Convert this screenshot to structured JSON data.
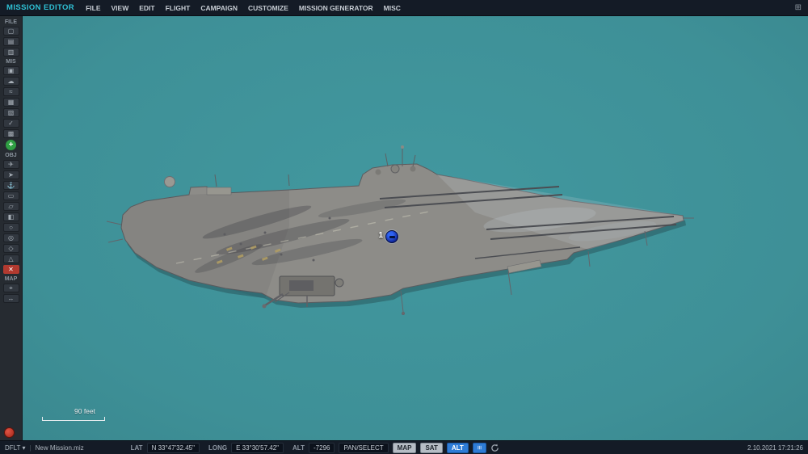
{
  "titlebar": {
    "app_title": "MISSION EDITOR",
    "menu_items": [
      "FILE",
      "VIEW",
      "EDIT",
      "FLIGHT",
      "CAMPAIGN",
      "CUSTOMIZE",
      "MISSION GENERATOR",
      "MISC"
    ],
    "window_icon": "⊞"
  },
  "toolbar": {
    "sections": [
      {
        "label": "FILE",
        "items": [
          {
            "name": "new-mission-icon",
            "glyph": "▢"
          },
          {
            "name": "open-mission-icon",
            "glyph": "▤"
          },
          {
            "name": "save-mission-icon",
            "glyph": "▥"
          }
        ]
      },
      {
        "label": "MIS",
        "items": [
          {
            "name": "briefing-icon",
            "glyph": "▣"
          },
          {
            "name": "weather-icon",
            "glyph": "☁"
          },
          {
            "name": "routes-icon",
            "glyph": "≈"
          },
          {
            "name": "mission-options-icon",
            "glyph": "▦"
          },
          {
            "name": "triggers-icon",
            "glyph": "▧"
          },
          {
            "name": "goals-icon",
            "glyph": "✓"
          },
          {
            "name": "summary-icon",
            "glyph": "▩"
          },
          {
            "name": "add-unit-icon",
            "glyph": "+",
            "bg": "#2f9e43",
            "fg": "#ffffff",
            "shape": "circle"
          }
        ]
      },
      {
        "label": "OBJ",
        "items": [
          {
            "name": "aircraft-icon",
            "glyph": "✈"
          },
          {
            "name": "helicopter-icon",
            "glyph": "➤"
          },
          {
            "name": "ship-icon",
            "glyph": "⚓"
          },
          {
            "name": "vehicle-icon",
            "glyph": "▭"
          },
          {
            "name": "static-object-icon",
            "glyph": "▱"
          },
          {
            "name": "template-icon",
            "glyph": "◧"
          },
          {
            "name": "zone-icon",
            "glyph": "○"
          },
          {
            "name": "bullseye-icon",
            "glyph": "◎"
          },
          {
            "name": "effects-icon",
            "glyph": "◇"
          },
          {
            "name": "label-icon",
            "glyph": "△"
          },
          {
            "name": "delete-icon",
            "glyph": "✕",
            "bg": "#b23a30",
            "fg": "#ffffff"
          }
        ]
      },
      {
        "label": "MAP",
        "items": [
          {
            "name": "map-options-icon",
            "glyph": "⌖"
          },
          {
            "name": "measure-distance-icon",
            "glyph": "↔"
          }
        ]
      }
    ]
  },
  "map": {
    "unit_label": "1",
    "scale_label": "90 feet"
  },
  "statusbar": {
    "preset": "DFLT",
    "caret": "▾",
    "separator": "|",
    "file_name": "New Mission.miz",
    "lat_label": "LAT",
    "lat_value": "N 33°47'32.45\"",
    "long_label": "LONG",
    "long_value": "E 33°30'57.42\"",
    "alt_label": "ALT",
    "alt_value": "-7296",
    "mode_button": "PAN/SELECT",
    "map_button": "MAP",
    "sat_button": "SAT",
    "alt_button": "ALT",
    "ruler_glyph": "≡",
    "datetime": "2.10.2021 17:21:26"
  },
  "colors": {
    "accent_cyan": "#2fc1d5",
    "accent_blue": "#2e7cd6",
    "sea_teal": "#40959c",
    "add_green": "#2f9e43",
    "alert_red": "#b23a30"
  }
}
